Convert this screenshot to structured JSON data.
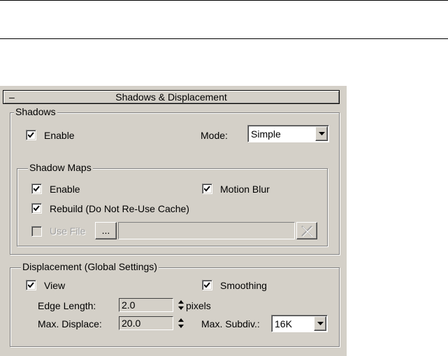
{
  "rollout": {
    "toggle": "–",
    "title": "Shadows & Displacement"
  },
  "shadows": {
    "legend": "Shadows",
    "enable_label": "Enable",
    "enable_checked": true,
    "mode_label": "Mode:",
    "mode_value": "Simple",
    "shadow_maps": {
      "legend": "Shadow Maps",
      "enable_label": "Enable",
      "enable_checked": true,
      "motion_blur_label": "Motion Blur",
      "motion_blur_checked": true,
      "rebuild_label": "Rebuild (Do Not Re-Use Cache)",
      "rebuild_checked": true,
      "use_file_label": "Use File",
      "use_file_checked": false,
      "browse_label": "...",
      "file_path": ""
    }
  },
  "displacement": {
    "legend": "Displacement (Global Settings)",
    "view_label": "View",
    "view_checked": true,
    "smoothing_label": "Smoothing",
    "smoothing_checked": true,
    "edge_length_label": "Edge Length:",
    "edge_length_value": "2.0",
    "edge_length_unit": "pixels",
    "max_displace_label": "Max. Displace:",
    "max_displace_value": "20.0",
    "max_subdiv_label": "Max. Subdiv.:",
    "max_subdiv_value": "16K"
  },
  "colors": {
    "panel_bg": "#d4d0c8",
    "disabled_text": "#a0a0a0"
  }
}
